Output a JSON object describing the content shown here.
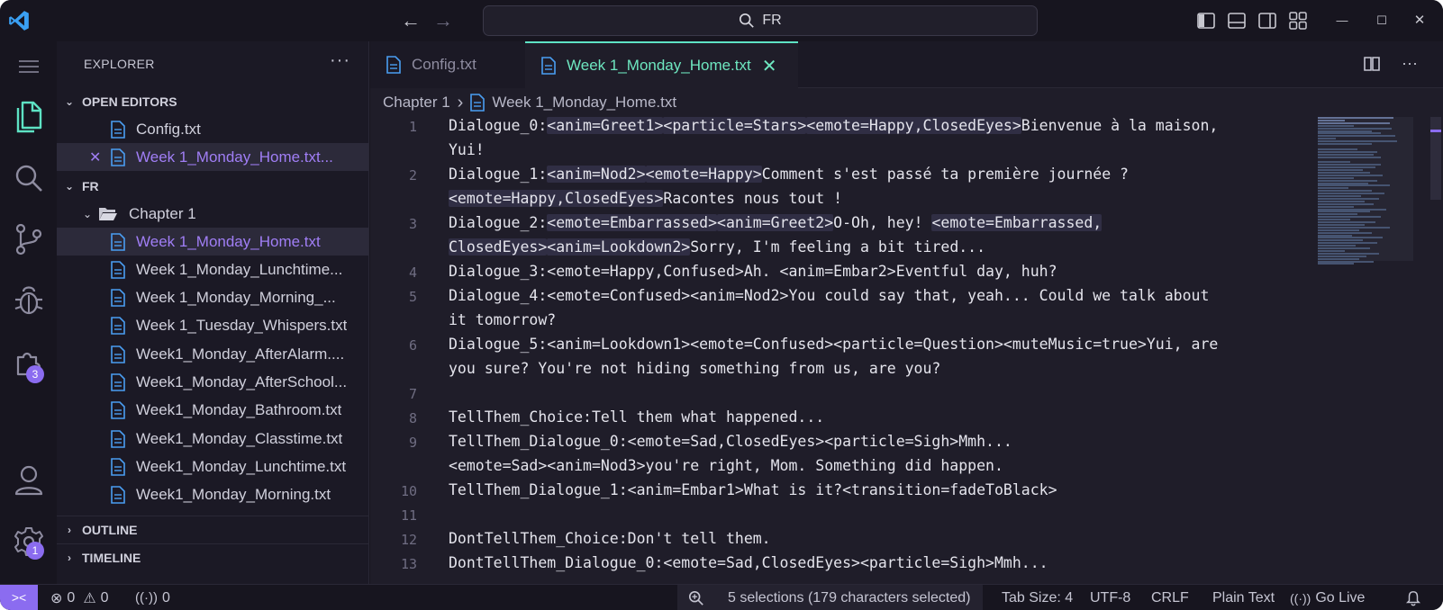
{
  "titlebar": {
    "search_text": "FR",
    "back_glyph": "←",
    "forward_glyph": "→",
    "min_glyph": "—",
    "max_glyph": "☐",
    "close_glyph": "✕"
  },
  "activity": {
    "extensions_badge": "3",
    "settings_badge": "1"
  },
  "sidebar": {
    "title": "EXPLORER",
    "more": "···",
    "open_editors_label": "OPEN EDITORS",
    "open_editors": [
      {
        "label": "Config.txt"
      },
      {
        "label": "Week 1_Monday_Home.txt..."
      }
    ],
    "folder_label": "FR",
    "chapter_label": "Chapter 1",
    "files": [
      {
        "label": "Week 1_Monday_Home.txt"
      },
      {
        "label": "Week 1_Monday_Lunchtime..."
      },
      {
        "label": "Week 1_Monday_Morning_..."
      },
      {
        "label": "Week 1_Tuesday_Whispers.txt"
      },
      {
        "label": "Week1_Monday_AfterAlarm...."
      },
      {
        "label": "Week1_Monday_AfterSchool..."
      },
      {
        "label": "Week1_Monday_Bathroom.txt"
      },
      {
        "label": "Week1_Monday_Classtime.txt"
      },
      {
        "label": "Week1_Monday_Lunchtime.txt"
      },
      {
        "label": "Week1_Monday_Morning.txt"
      }
    ],
    "outline_label": "OUTLINE",
    "timeline_label": "TIMELINE"
  },
  "editor": {
    "tabs": [
      {
        "label": "Config.txt"
      },
      {
        "label": "Week 1_Monday_Home.txt"
      }
    ],
    "tab_close": "✕",
    "breadcrumb_folder": "Chapter 1",
    "breadcrumb_sep": "›",
    "breadcrumb_file": "Week 1_Monday_Home.txt",
    "lines": [
      {
        "n": "1",
        "segs": [
          [
            "Dialogue_0:",
            0
          ],
          [
            "<anim=Greet1>",
            1
          ],
          [
            "<particle=Stars>",
            1
          ],
          [
            "<emote=Happy,ClosedEyes>",
            1
          ],
          [
            "Bienvenue à la maison,",
            0
          ]
        ]
      },
      {
        "n": "",
        "segs": [
          [
            "Yui!",
            0
          ]
        ]
      },
      {
        "n": "2",
        "segs": [
          [
            "Dialogue_1:",
            0
          ],
          [
            "<anim=Nod2>",
            1
          ],
          [
            "<emote=Happy>",
            1
          ],
          [
            "Comment s'est passé ta première journée ?",
            0
          ]
        ]
      },
      {
        "n": "",
        "segs": [
          [
            "<emote=Happy,ClosedEyes>",
            1
          ],
          [
            "Racontes nous tout !",
            0
          ]
        ]
      },
      {
        "n": "3",
        "segs": [
          [
            "Dialogue_2:",
            0
          ],
          [
            "<emote=Embarrassed>",
            1
          ],
          [
            "<anim=Greet2>",
            1
          ],
          [
            "O-Oh, hey! ",
            0
          ],
          [
            "<emote=Embarrassed,",
            1
          ]
        ]
      },
      {
        "n": "",
        "segs": [
          [
            "ClosedEyes>",
            1
          ],
          [
            "<anim=Lookdown2>",
            1
          ],
          [
            "Sorry, I'm feeling a bit tired...",
            0
          ]
        ]
      },
      {
        "n": "4",
        "segs": [
          [
            "Dialogue_3:<emote=Happy,Confused>Ah. <anim=Embar2>Eventful day, huh?",
            0
          ]
        ]
      },
      {
        "n": "5",
        "segs": [
          [
            "Dialogue_4:<emote=Confused><anim=Nod2>You could say that, yeah... Could we talk about",
            0
          ]
        ]
      },
      {
        "n": "",
        "segs": [
          [
            "it tomorrow?",
            0
          ]
        ]
      },
      {
        "n": "6",
        "segs": [
          [
            "Dialogue_5:<anim=Lookdown1><emote=Confused><particle=Question><muteMusic=true>Yui, are",
            0
          ]
        ]
      },
      {
        "n": "",
        "segs": [
          [
            "you sure? You're not hiding something from us, are you?",
            0
          ]
        ]
      },
      {
        "n": "7",
        "segs": [
          [
            "",
            0
          ]
        ]
      },
      {
        "n": "8",
        "segs": [
          [
            "TellThem_Choice:Tell them what happened...",
            0
          ]
        ]
      },
      {
        "n": "9",
        "segs": [
          [
            "TellThem_Dialogue_0:<emote=Sad,ClosedEyes><particle=Sigh>Mmh...",
            0
          ]
        ]
      },
      {
        "n": "",
        "segs": [
          [
            "<emote=Sad><anim=Nod3>you're right, Mom. Something did happen.",
            0
          ]
        ]
      },
      {
        "n": "10",
        "segs": [
          [
            "TellThem_Dialogue_1:<anim=Embar1>What is it?<transition=fadeToBlack>",
            0
          ]
        ]
      },
      {
        "n": "11",
        "segs": [
          [
            "",
            0
          ]
        ]
      },
      {
        "n": "12",
        "segs": [
          [
            "DontTellThem_Choice:Don't tell them.",
            0
          ]
        ]
      },
      {
        "n": "13",
        "segs": [
          [
            "DontTellThem_Dialogue_0:<emote=Sad,ClosedEyes><particle=Sigh>Mmh...",
            0
          ]
        ]
      }
    ]
  },
  "statusbar": {
    "remote_glyph": "><",
    "errors": "0",
    "warnings": "0",
    "ports": "0",
    "selection": "5 selections (179 characters selected)",
    "tab_size": "Tab Size: 4",
    "encoding": "UTF-8",
    "eol": "CRLF",
    "language": "Plain Text",
    "go_live": "Go Live"
  },
  "colors": {
    "accent": "#8b6cf0",
    "active_tab_text": "#6ee7c0",
    "background": "#1f1d29"
  }
}
